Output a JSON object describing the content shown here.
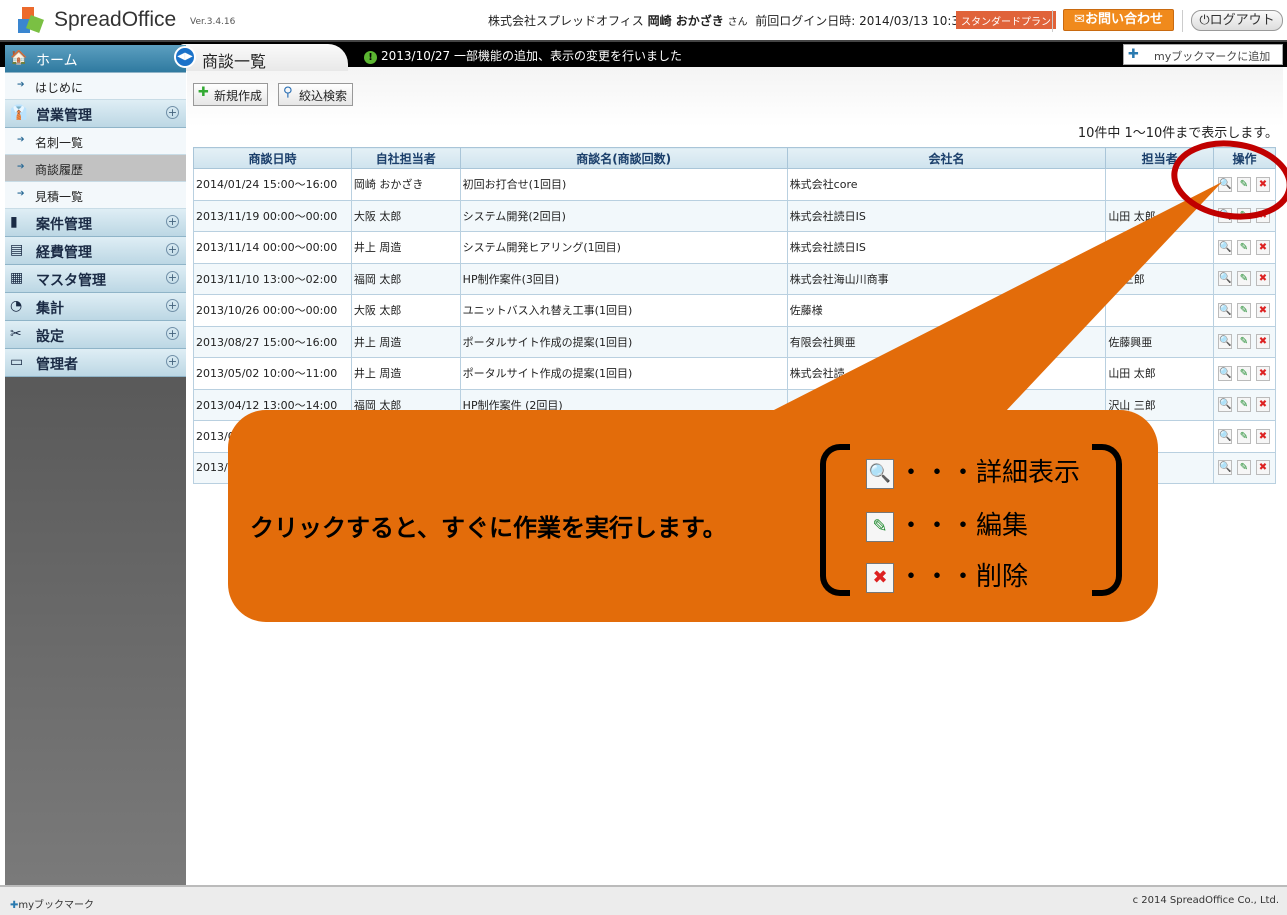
{
  "header": {
    "brand": "SpreadOffice",
    "tm": "™",
    "version": "Ver.3.4.16",
    "company": "株式会社スプレッドオフィス",
    "user_name": "岡崎 おかざき",
    "honorific": "さん",
    "last_login": "前回ログイン日時: 2014/03/13 10:36:10",
    "plan": "スタンダードプラン",
    "contact": "お問い合わせ",
    "logout": "ログアウト"
  },
  "navbar": {
    "tab_title": "商談一覧",
    "notice": "2013/10/27 一部機能の追加、表示の変更を行いました",
    "bookmark_add": "myブックマークに追加"
  },
  "sidebar": {
    "home": "ホーム",
    "items": [
      {
        "label": "はじめに",
        "type": "sub"
      },
      {
        "label": "営業管理",
        "type": "group",
        "icon": "sales-icon"
      },
      {
        "label": "名刺一覧",
        "type": "sub"
      },
      {
        "label": "商談履歴",
        "type": "sub",
        "active": true
      },
      {
        "label": "見積一覧",
        "type": "sub"
      },
      {
        "label": "案件管理",
        "type": "group",
        "icon": "project-icon"
      },
      {
        "label": "経費管理",
        "type": "group",
        "icon": "expense-icon"
      },
      {
        "label": "マスタ管理",
        "type": "group",
        "icon": "master-icon"
      },
      {
        "label": "集計",
        "type": "group",
        "icon": "pie-chart-icon"
      },
      {
        "label": "設定",
        "type": "group",
        "icon": "tools-icon"
      },
      {
        "label": "管理者",
        "type": "group",
        "icon": "monitor-icon"
      }
    ]
  },
  "toolbar": {
    "new": "新規作成",
    "search": "絞込検索"
  },
  "count": "10件中 1～10件まで表示します。",
  "table": {
    "headers": [
      "商談日時",
      "自社担当者",
      "商談名(商談回数)",
      "会社名",
      "担当者",
      "操作"
    ],
    "rows": [
      [
        "2014/01/24 15:00～16:00",
        "岡崎 おかざき",
        "初回お打合せ(1回目)",
        "株式会社core",
        ""
      ],
      [
        "2013/11/19 00:00～00:00",
        "大阪 太郎",
        "システム開発(2回目)",
        "株式会社読日IS",
        "山田 太郎"
      ],
      [
        "2013/11/14 00:00～00:00",
        "井上 周造",
        "システム開発ヒアリング(1回目)",
        "株式会社読日IS",
        "郎"
      ],
      [
        "2013/11/10 13:00～02:00",
        "福岡 太郎",
        "HP制作案件(3回目)",
        "株式会社海山川商事",
        "山 三郎"
      ],
      [
        "2013/10/26 00:00～00:00",
        "大阪 太郎",
        "ユニットバス入れ替え工事(1回目)",
        "佐藤様",
        ""
      ],
      [
        "2013/08/27 15:00～16:00",
        "井上 周造",
        "ポータルサイト作成の提案(1回目)",
        "有限会社興亜",
        "佐藤興亜"
      ],
      [
        "2013/05/02 10:00～11:00",
        "井上 周造",
        "ポータルサイト作成の提案(1回目)",
        "株式会社読",
        "山田 太郎"
      ],
      [
        "2013/04/12 13:00～14:00",
        "福岡 太郎",
        "HP制作案件 (2回目)",
        "",
        "沢山 三郎"
      ],
      [
        "2013/0",
        "",
        "",
        "",
        "郎"
      ],
      [
        "2013/0",
        "",
        "",
        "",
        ""
      ]
    ]
  },
  "callout": {
    "text": "クリックすると、すぐに作業を実行します。",
    "view": "・・・詳細表示",
    "edit": "・・・編集",
    "delete": "・・・削除",
    "color": "#E36C0A",
    "highlight": "#C00000"
  },
  "footer": {
    "bookmark": "myブックマーク",
    "copyright": "c 2014 SpreadOffice Co., Ltd."
  }
}
